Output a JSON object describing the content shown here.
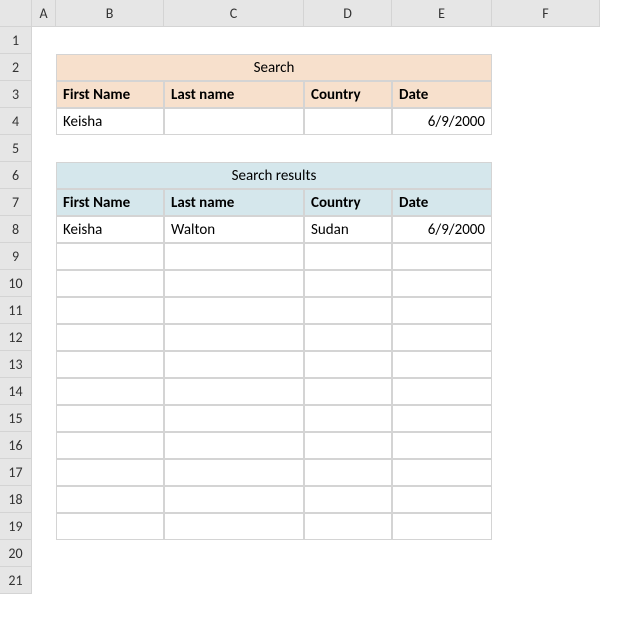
{
  "columns": [
    "A",
    "B",
    "C",
    "D",
    "E",
    "F"
  ],
  "rows": [
    "1",
    "2",
    "3",
    "4",
    "5",
    "6",
    "7",
    "8",
    "9",
    "10",
    "11",
    "12",
    "13",
    "14",
    "15",
    "16",
    "17",
    "18",
    "19",
    "20",
    "21"
  ],
  "search": {
    "title": "Search",
    "headers": {
      "first": "First Name",
      "last": "Last  name",
      "country": "Country",
      "date": "Date"
    },
    "row": {
      "first": "Keisha",
      "last": "",
      "country": "",
      "date": "6/9/2000"
    }
  },
  "results": {
    "title": "Search results",
    "headers": {
      "first": "First Name",
      "last": "Last  name",
      "country": "Country",
      "date": "Date"
    },
    "rows": [
      {
        "first": "Keisha",
        "last": "Walton",
        "country": "Sudan",
        "date": "6/9/2000"
      },
      {
        "first": "",
        "last": "",
        "country": "",
        "date": ""
      },
      {
        "first": "",
        "last": "",
        "country": "",
        "date": ""
      },
      {
        "first": "",
        "last": "",
        "country": "",
        "date": ""
      },
      {
        "first": "",
        "last": "",
        "country": "",
        "date": ""
      },
      {
        "first": "",
        "last": "",
        "country": "",
        "date": ""
      },
      {
        "first": "",
        "last": "",
        "country": "",
        "date": ""
      },
      {
        "first": "",
        "last": "",
        "country": "",
        "date": ""
      },
      {
        "first": "",
        "last": "",
        "country": "",
        "date": ""
      },
      {
        "first": "",
        "last": "",
        "country": "",
        "date": ""
      },
      {
        "first": "",
        "last": "",
        "country": "",
        "date": ""
      },
      {
        "first": "",
        "last": "",
        "country": "",
        "date": ""
      }
    ]
  }
}
